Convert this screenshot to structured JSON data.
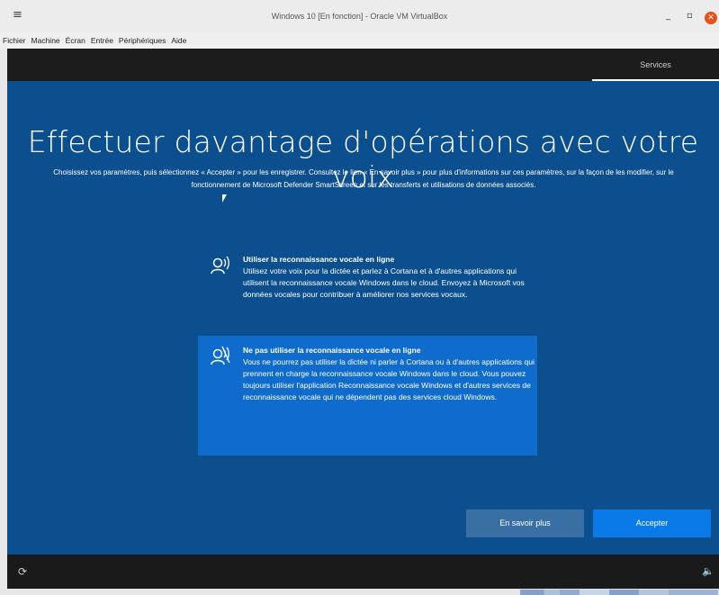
{
  "window": {
    "title": "Windows 10 [En fonction] - Oracle VM VirtualBox",
    "menu_icon": "≡",
    "minimize": "_",
    "maximize": "▫",
    "close": "✕"
  },
  "menubar": [
    "Fichier",
    "Machine",
    "Écran",
    "Entrée",
    "Périphériques",
    "Aide"
  ],
  "vm": {
    "tab": "Services",
    "heading": "Effectuer davantage d'opérations avec votre voix",
    "subtext": "Choisissez vos paramètres, puis sélectionnez « Accepter » pour les enregistrer. Consultez le lien « En savoir plus » pour plus d'informations sur ces paramètres, sur la façon de les modifier, sur le fonctionnement de Microsoft Defender SmartScreen et sur les transferts et utilisations de données associés.",
    "options": [
      {
        "title": "Utiliser la reconnaissance vocale en ligne",
        "desc": "Utilisez votre voix pour la dictée et parlez à Cortana et à d'autres applications qui utilisent la reconnaissance vocale Windows dans le cloud. Envoyez à Microsoft vos données vocales pour contribuer à améliorer nos services vocaux.",
        "selected": false
      },
      {
        "title": "Ne pas utiliser la reconnaissance vocale en ligne",
        "desc": "Vous ne pourrez pas utiliser la dictée ni parler à Cortana ou à d'autres applications qui prennent en charge la reconnaissance vocale Windows dans le cloud. Vous pouvez toujours utiliser l'application Reconnaissance vocale Windows et d'autres services de reconnaissance vocale qui ne dépendent pas des services cloud Windows.",
        "selected": true
      }
    ],
    "buttons": {
      "learn_more": "En savoir plus",
      "accept": "Accepter"
    },
    "bottom": {
      "ease_icon": "⟳",
      "volume_icon": "🔈"
    }
  },
  "colors": {
    "oobe_bg": "#0b4f8f",
    "selected_option": "#0f6ccc",
    "accept_button": "#0a7ae8",
    "learn_more_button": "#3a6fa3"
  }
}
